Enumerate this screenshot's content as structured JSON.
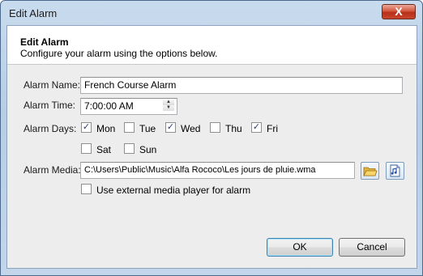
{
  "window": {
    "title": "Edit Alarm",
    "close_label": "X"
  },
  "header": {
    "title": "Edit Alarm",
    "subtitle": "Configure your alarm using the options below."
  },
  "form": {
    "name_label": "Alarm Name:",
    "name_value": "French Course Alarm",
    "time_label": "Alarm Time:",
    "time_value": "7:00:00 AM",
    "days_label": "Alarm Days:",
    "days": [
      {
        "label": "Mon",
        "checked": true
      },
      {
        "label": "Tue",
        "checked": false
      },
      {
        "label": "Wed",
        "checked": true
      },
      {
        "label": "Thu",
        "checked": false
      },
      {
        "label": "Fri",
        "checked": true
      },
      {
        "label": "Sat",
        "checked": false
      },
      {
        "label": "Sun",
        "checked": false
      }
    ],
    "media_label": "Alarm Media:",
    "media_value": "C:\\Users\\Public\\Music\\Alfa Rococo\\Les jours de pluie.wma",
    "external_player_label": "Use external media player for alarm",
    "external_player_checked": false
  },
  "buttons": {
    "ok_label": "OK",
    "cancel_label": "Cancel"
  },
  "icons": {
    "browse": "folder-open-icon",
    "preview": "media-file-icon"
  }
}
